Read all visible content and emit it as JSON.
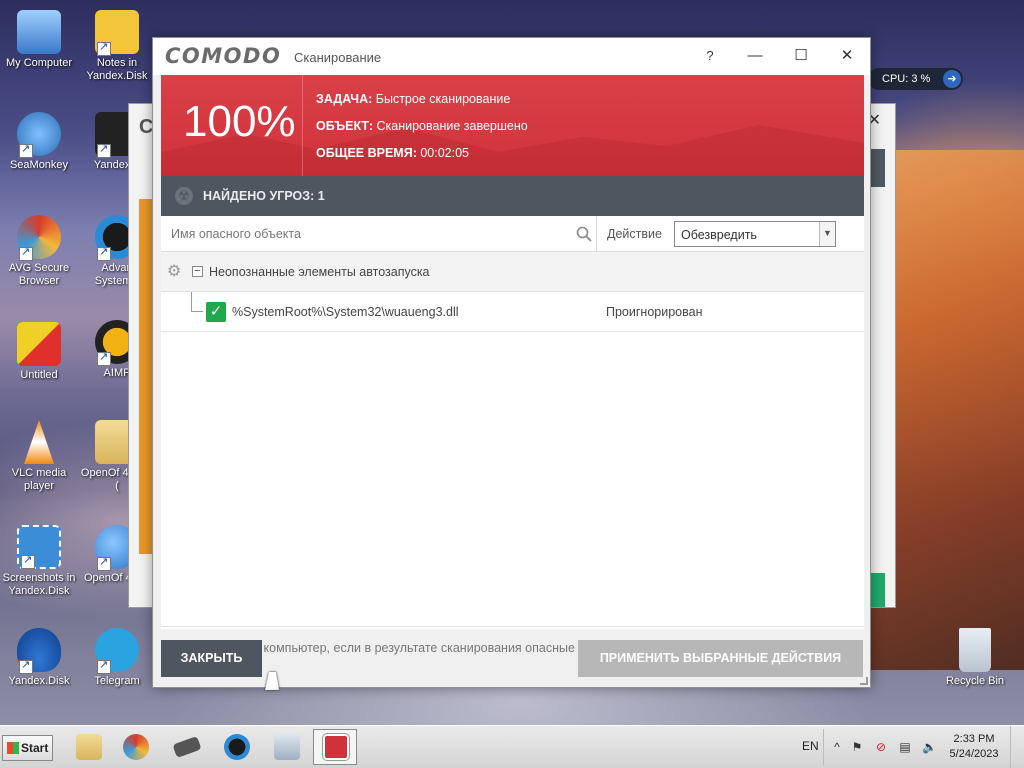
{
  "desktop": {
    "icons_left": [
      {
        "label": "My Computer",
        "color": "#3a78c8"
      },
      {
        "label": "SeaMonkey",
        "color": "#2c6fb5"
      },
      {
        "label": "AVG Secure Browser",
        "color": "#d93a2b"
      },
      {
        "label": "Untitled",
        "color": "#e0302c"
      },
      {
        "label": "VLC media player",
        "color": "#f08a10"
      },
      {
        "label": "Screenshots in Yandex.Disk",
        "color": "#3c8dd8"
      },
      {
        "label": "Yandex.Disk",
        "color": "#2f78d6"
      }
    ],
    "icons_second": [
      {
        "label": "Notes in Yandex.Disk",
        "color": "#f3c63a"
      },
      {
        "label": "Yandex.T",
        "color": "#222222"
      },
      {
        "label": "Advan SystemC",
        "color": "#2a8ad6"
      },
      {
        "label": "AIMP",
        "color": "#f2b214"
      },
      {
        "label": "OpenOf 4.1.14 (",
        "color": "#e8c56a"
      },
      {
        "label": "OpenOf 4.1.1",
        "color": "#2a72c6"
      },
      {
        "label": "Telegram",
        "color": "#2aa3e0"
      }
    ],
    "recycle_bin": "Recycle Bin",
    "cpu_widget": "CPU: 3 %"
  },
  "window": {
    "brand": "COMODO",
    "title": "Сканирование",
    "help": "?",
    "minimize": "—",
    "maximize": "☐",
    "close": "✕",
    "progress_percent": "100%",
    "task_label": "ЗАДАЧА:",
    "task_value": "Быстрое сканирование",
    "object_label": "ОБЪЕКТ:",
    "object_value": "Сканирование завершено",
    "time_label": "ОБЩЕЕ ВРЕМЯ:",
    "time_value": "00:02:05",
    "threats_label": "НАЙДЕНО УГРОЗ:",
    "threats_count": "1",
    "column_name_placeholder": "Имя опасного объекта",
    "action_label": "Действие",
    "action_select_value": "Обезвредить",
    "group_label": "Неопознанные элементы автозапуска",
    "item_path": "%SystemRoot%\\System32\\wuaueng3.dll",
    "item_status": "Проигнорирован",
    "shutdown_option": "Выключить компьютер, если в результате сканирования опасные объекты не обнаружены",
    "close_button": "ЗАКРЫТЬ",
    "apply_button": "ПРИМЕНИТЬ ВЫБРАННЫЕ ДЕЙСТВИЯ",
    "colors": {
      "banner": "#d0323c",
      "dark_bar": "#4f5660",
      "check": "#20a84d",
      "apply_disabled": "#b7b7b7"
    }
  },
  "taskbar": {
    "start_label": "Start",
    "language": "EN",
    "time": "2:33 PM",
    "date": "5/24/2023",
    "apps": [
      {
        "icon": "folder-icon",
        "active": false
      },
      {
        "icon": "avg-browser-icon",
        "active": false
      },
      {
        "icon": "chip-icon",
        "active": false
      },
      {
        "icon": "advanced-systemcare-icon",
        "active": false
      },
      {
        "icon": "keyboard-icon",
        "active": false
      },
      {
        "icon": "comodo-icon",
        "active": true
      }
    ]
  }
}
